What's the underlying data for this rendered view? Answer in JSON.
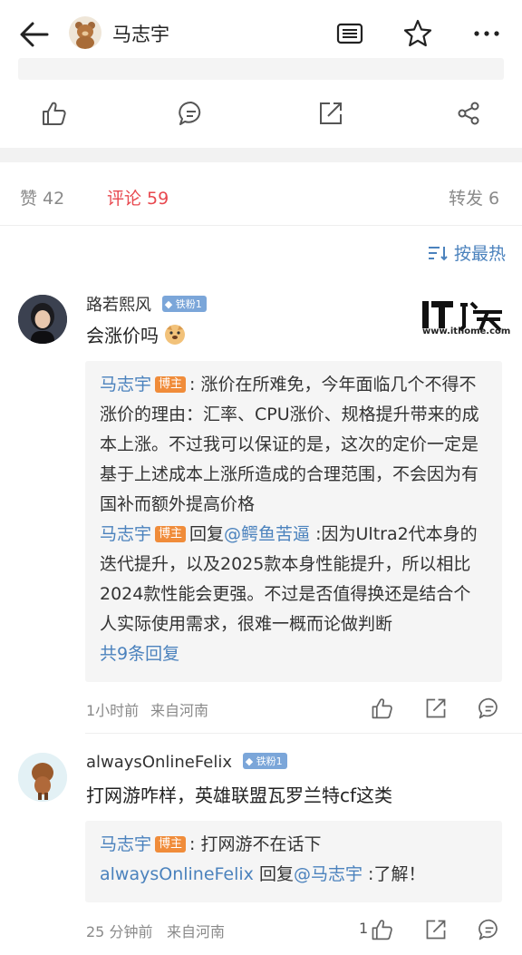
{
  "header": {
    "author_name": "马志宇"
  },
  "post_actions": [
    "like",
    "comment",
    "repost",
    "share"
  ],
  "stats": {
    "likes": "赞 42",
    "comments": "评论 59",
    "reposts": "转发 6"
  },
  "sort_label": "按最热",
  "watermark": {
    "url": "www.ithome.com"
  },
  "comments": [
    {
      "user": "路若熙风",
      "fan_badge": "铁粉1",
      "text": "会涨价吗",
      "replies": [
        {
          "name": "马志宇",
          "tag": "博主",
          "text": ": 涨价在所难免，今年面临几个不得不涨价的理由：汇率、CPU涨价、规格提升带来的成本上涨。不过我可以保证的是，这次的定价一定是基于上述成本上涨所造成的合理范围，不会因为有国补而额外提高价格"
        },
        {
          "name": "马志宇",
          "tag": "博主",
          "reply_word": "回复",
          "reply_to": "@鳄鱼苦逼",
          "text": " :因为Ultra2代本身的迭代提升，以及2025款本身性能提升，所以相比2024款性能会更强。不过是否值得换还是结合个人实际使用需求，很难一概而论做判断"
        }
      ],
      "more_replies": "共9条回复",
      "time": "1小时前",
      "location": "来自河南",
      "likes": ""
    },
    {
      "user": "alwaysOnlineFelix",
      "fan_badge": "铁粉1",
      "text": "打网游咋样，英雄联盟瓦罗兰特cf这类",
      "replies": [
        {
          "name": "马志宇",
          "tag": "博主",
          "text": ": 打网游不在话下"
        },
        {
          "name": "alwaysOnlineFelix",
          "reply_word": "回复",
          "reply_to": "@马志宇",
          "text": " :了解！"
        }
      ],
      "time": "25 分钟前",
      "location": "来自河南",
      "likes": "1"
    }
  ]
}
